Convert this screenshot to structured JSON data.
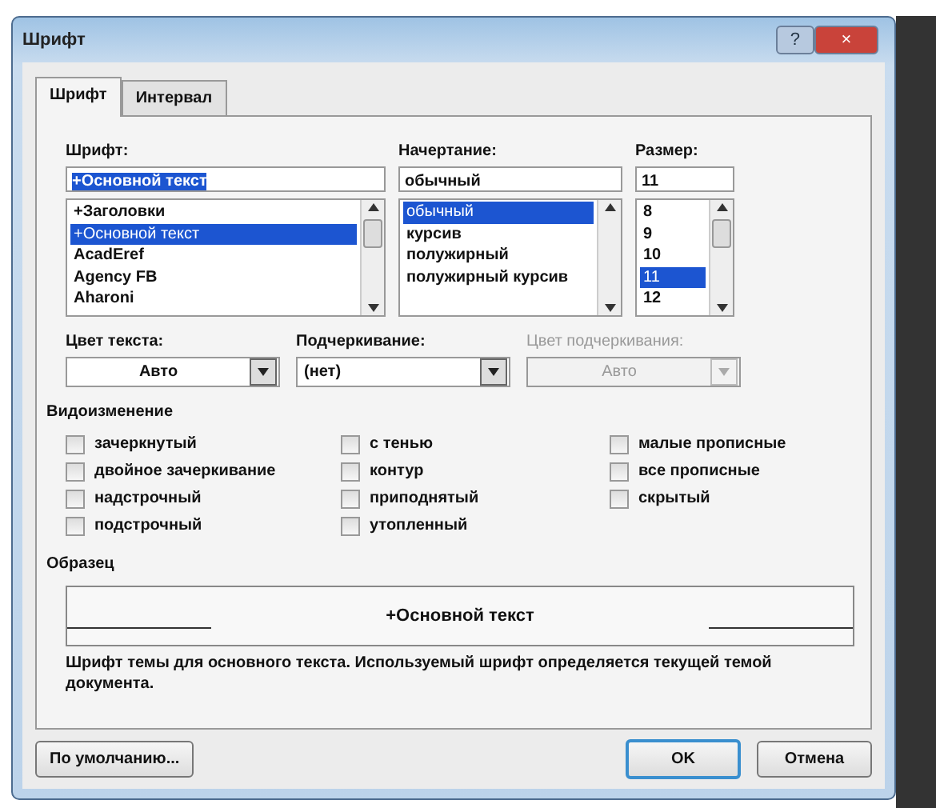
{
  "window": {
    "title": "Шрифт",
    "help": "?",
    "close": "×"
  },
  "tabs": [
    {
      "label": "Шрифт",
      "selected": true
    },
    {
      "label": "Интервал",
      "selected": false
    }
  ],
  "font": {
    "label": "Шрифт:",
    "value": "+Основной текст",
    "items": [
      {
        "label": "+Заголовки",
        "selected": false
      },
      {
        "label": "+Основной текст",
        "selected": true
      },
      {
        "label": "AcadEref",
        "selected": false
      },
      {
        "label": "Agency FB",
        "selected": false
      },
      {
        "label": "Aharoni",
        "selected": false
      }
    ]
  },
  "style": {
    "label": "Начертание:",
    "value": "обычный",
    "items": [
      {
        "label": "обычный",
        "selected": true
      },
      {
        "label": "курсив",
        "selected": false
      },
      {
        "label": "полужирный",
        "selected": false
      },
      {
        "label": "полужирный курсив",
        "selected": false
      }
    ]
  },
  "size": {
    "label": "Размер:",
    "value": "11",
    "items": [
      {
        "label": "8",
        "selected": false
      },
      {
        "label": "9",
        "selected": false
      },
      {
        "label": "10",
        "selected": false
      },
      {
        "label": "11",
        "selected": true
      },
      {
        "label": "12",
        "selected": false
      }
    ]
  },
  "dropdowns": [
    {
      "label": "Цвет текста:",
      "value": "Авто",
      "disabled": false,
      "centered": true
    },
    {
      "label": "Подчеркивание:",
      "value": "(нет)",
      "disabled": false,
      "centered": false
    },
    {
      "label": "Цвет подчеркивания:",
      "value": "Авто",
      "disabled": true,
      "centered": true
    }
  ],
  "effects": {
    "title": "Видоизменение",
    "columns": [
      [
        {
          "label": "зачеркнутый",
          "checked": false
        },
        {
          "label": "двойное зачеркивание",
          "checked": false
        },
        {
          "label": "надстрочный",
          "checked": false
        },
        {
          "label": "подстрочный",
          "checked": false
        }
      ],
      [
        {
          "label": "с тенью",
          "checked": false
        },
        {
          "label": "контур",
          "checked": false
        },
        {
          "label": "приподнятый",
          "checked": false
        },
        {
          "label": "утопленный",
          "checked": false
        }
      ],
      [
        {
          "label": "малые прописные",
          "checked": false
        },
        {
          "label": "все прописные",
          "checked": false
        },
        {
          "label": "скрытый",
          "checked": false
        }
      ]
    ]
  },
  "preview": {
    "title": "Образец",
    "sample": "+Основной текст",
    "description": "Шрифт темы для основного текста. Используемый шрифт определяется текущей темой документа."
  },
  "buttons": [
    {
      "label": "По умолчанию...",
      "kind": "secondary"
    },
    {
      "label": "OK",
      "kind": "default"
    },
    {
      "label": "Отмена",
      "kind": "secondary"
    }
  ]
}
